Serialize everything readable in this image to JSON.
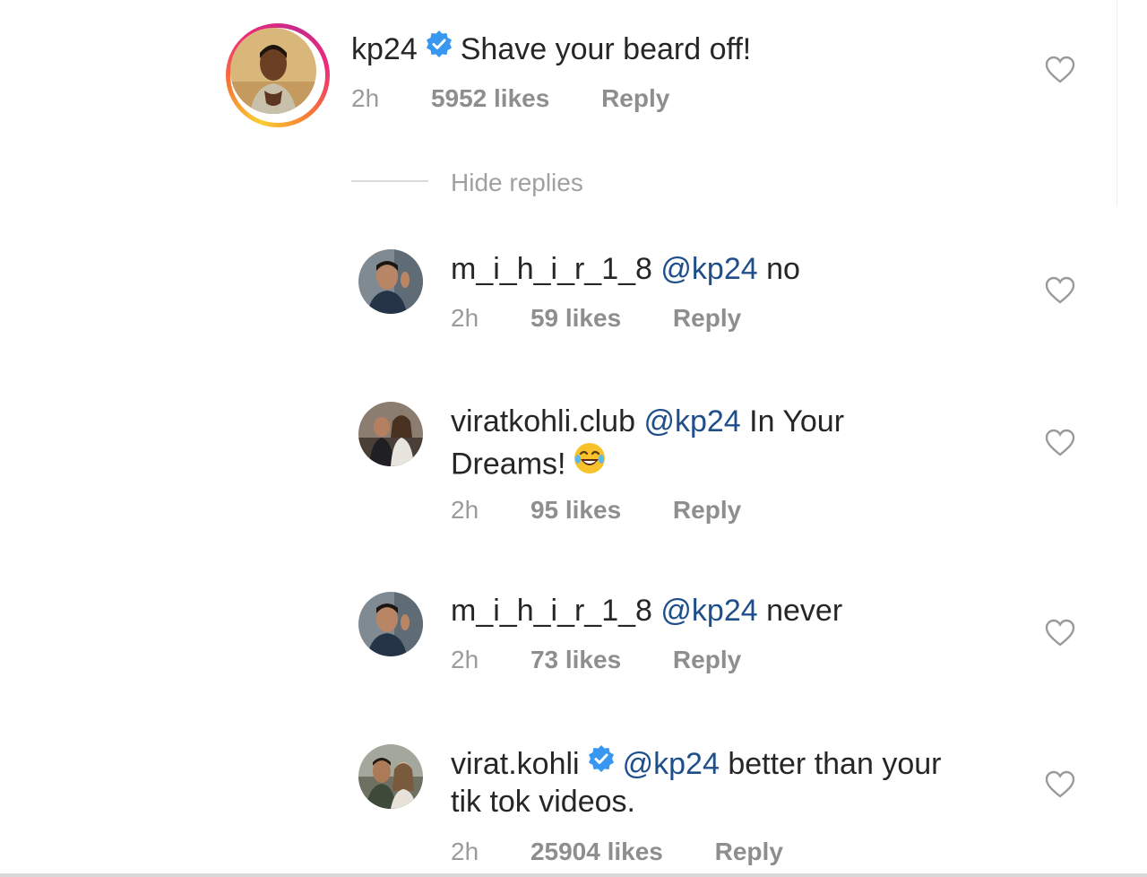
{
  "comments": [
    {
      "username": "kp24",
      "verified": true,
      "text": "Shave your beard off!",
      "time": "2h",
      "likes": "5952 likes",
      "reply": "Reply"
    },
    {
      "username": "m_i_h_i_r_1_8",
      "mention": "@kp24",
      "text": "no",
      "time": "2h",
      "likes": "59 likes",
      "reply": "Reply"
    },
    {
      "username": "viratkohli.club",
      "mention": "@kp24",
      "text_line1": "In Your",
      "text_line2": "Dreams!",
      "time": "2h",
      "likes": "95 likes",
      "reply": "Reply"
    },
    {
      "username": "m_i_h_i_r_1_8",
      "mention": "@kp24",
      "text": "never",
      "time": "2h",
      "likes": "73 likes",
      "reply": "Reply"
    },
    {
      "username": "virat.kohli",
      "verified": true,
      "mention": "@kp24",
      "text_line1": "better than your",
      "text_line2": "tik tok videos.",
      "time": "2h",
      "likes": "25904 likes",
      "reply": "Reply"
    }
  ],
  "hide_replies": "Hide replies",
  "colors": {
    "mention": "#1f4f8a",
    "verified": "#3897f0",
    "meta": "#8e8e8e"
  },
  "icons": [
    "heart-icon",
    "verified-badge-icon",
    "laughing-emoji-icon"
  ]
}
